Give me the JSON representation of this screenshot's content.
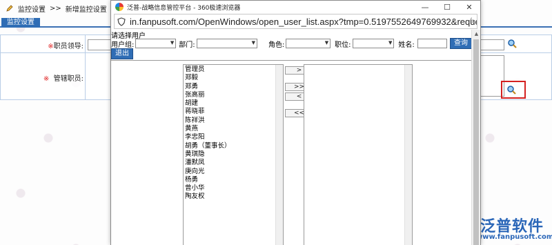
{
  "background": {
    "breadcrumb": [
      "监控设置",
      ">>",
      "新增监控设置"
    ],
    "tab_label": "监控设置",
    "form": {
      "row1_label": "职员领导:",
      "row2_label": "管辖职员:",
      "required_mark": "※"
    },
    "watermark": {
      "brand": "泛普软件",
      "url": "www.fanpusoft.com"
    }
  },
  "popup": {
    "window_title": "泛普-战略信息管控平台 - 360极速浏览器",
    "window_buttons": [
      "—",
      "☐",
      "✕"
    ],
    "address": "in.fanpusoft.com/OpenWindows/open_user_list.aspx?tmp=0.5197552649769932&request",
    "select_user_title": "请选择用户",
    "filters": {
      "user_group_label": "用户组:",
      "department_label": "部门:",
      "role_label": "角色:",
      "position_label": "职位:",
      "name_label": "姓名:",
      "query_label": "查询"
    },
    "exit_label": "退出",
    "users": [
      "管理员",
      "郑毅",
      "郑勇",
      "张高丽",
      "胡建",
      "蒋晓菲",
      "陈祥洪",
      "黄燕",
      "李忠阳",
      "胡勇（董事长）",
      "黄琪隐",
      "潘默凤",
      "庚向光",
      "杨勇",
      "曾小华",
      "陶友权"
    ],
    "move_buttons": [
      ">",
      ">>",
      "<",
      "<<"
    ]
  }
}
